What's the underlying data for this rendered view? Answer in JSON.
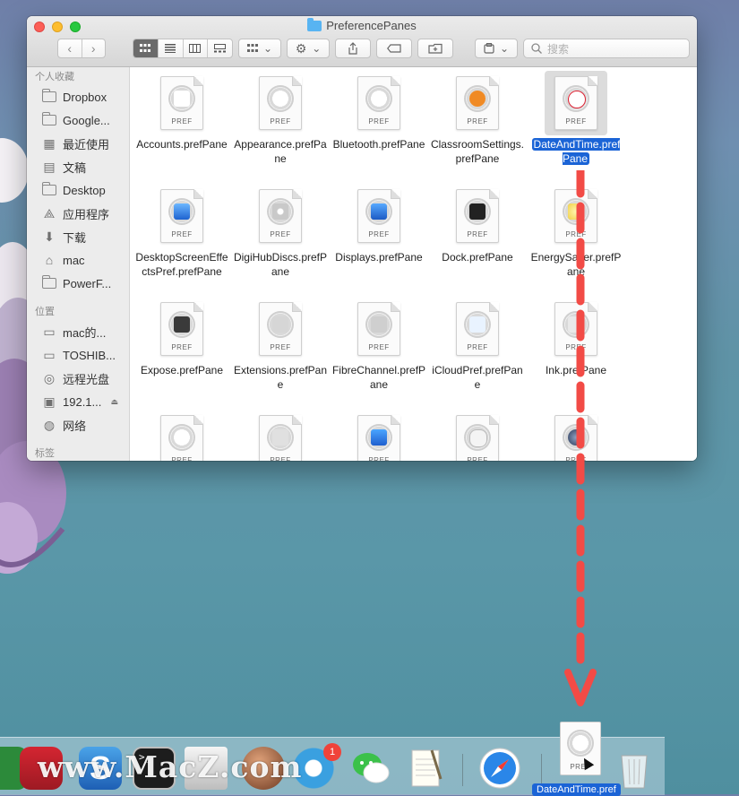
{
  "window": {
    "title": "PreferencePanes",
    "search_placeholder": "搜索"
  },
  "sidebar": {
    "favorites_header": "个人收藏",
    "favorites": [
      {
        "label": "Dropbox",
        "icon": "folder-icon"
      },
      {
        "label": "Google...",
        "icon": "folder-icon"
      },
      {
        "label": "最近使用",
        "icon": "recents-icon"
      },
      {
        "label": "文稿",
        "icon": "documents-icon"
      },
      {
        "label": "Desktop",
        "icon": "folder-icon"
      },
      {
        "label": "应用程序",
        "icon": "applications-icon"
      },
      {
        "label": "下载",
        "icon": "downloads-icon"
      },
      {
        "label": "mac",
        "icon": "home-icon"
      },
      {
        "label": "PowerF...",
        "icon": "folder-icon"
      }
    ],
    "locations_header": "位置",
    "locations": [
      {
        "label": "mac的...",
        "icon": "disk-icon"
      },
      {
        "label": "TOSHIB...",
        "icon": "external-disk-icon"
      },
      {
        "label": "远程光盘",
        "icon": "optical-disc-icon"
      },
      {
        "label": "192.1...",
        "icon": "server-icon"
      },
      {
        "label": "网络",
        "icon": "network-icon"
      }
    ],
    "tags_header": "标签"
  },
  "files": [
    {
      "name": "Accounts.prefPane",
      "badge": "accounts"
    },
    {
      "name": "Appearance.prefPane",
      "badge": ""
    },
    {
      "name": "Bluetooth.prefPane",
      "badge": ""
    },
    {
      "name": "ClassroomSettings.prefPane",
      "badge": "classroom"
    },
    {
      "name": "DateAndTime.prefPane",
      "badge": "datetime",
      "selected": true
    },
    {
      "name": "DesktopScreenEffectsPref.prefPane",
      "badge": "desktop"
    },
    {
      "name": "DigiHubDiscs.prefPane",
      "badge": "disc"
    },
    {
      "name": "Displays.prefPane",
      "badge": "display"
    },
    {
      "name": "Dock.prefPane",
      "badge": "dock"
    },
    {
      "name": "EnergySaver.prefPane",
      "badge": "energy"
    },
    {
      "name": "Expose.prefPane",
      "badge": "expose"
    },
    {
      "name": "Extensions.prefPane",
      "badge": "extensions"
    },
    {
      "name": "FibreChannel.prefPane",
      "badge": "fibre"
    },
    {
      "name": "iCloudPref.prefPane",
      "badge": "icloud"
    },
    {
      "name": "Ink.prefPane",
      "badge": "ink"
    },
    {
      "name": "",
      "badge": ""
    },
    {
      "name": "",
      "badge": "keyboard"
    },
    {
      "name": "",
      "badge": "language"
    },
    {
      "name": "",
      "badge": "mouse"
    },
    {
      "name": "",
      "badge": "network"
    }
  ],
  "pref_text": "PREF",
  "dock": {
    "drag_label": "DateAndTime.pref",
    "notification_count": "1",
    "watermark": "www.MacZ.com"
  },
  "colors": {
    "selection": "#1b64d6",
    "arrow": "#f24b46"
  }
}
